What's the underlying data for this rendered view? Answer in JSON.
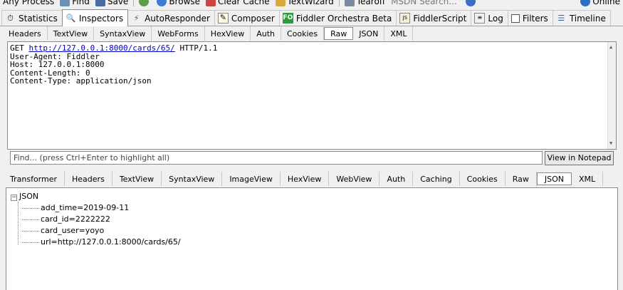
{
  "toolbar": {
    "items": [
      {
        "label": "Any Process",
        "icon": "crosshair-icon"
      },
      {
        "label": "Find",
        "icon": "find-icon"
      },
      {
        "label": "Save",
        "icon": "save-icon"
      },
      {
        "label": "",
        "icon": "snapshot-icon"
      },
      {
        "label": "Browse",
        "icon": "browse-icon"
      },
      {
        "label": "Clear Cache",
        "icon": "clear-cache-icon"
      },
      {
        "label": "TextWizard",
        "icon": "textwizard-icon"
      },
      {
        "label": "Tearoff",
        "icon": "tearoff-icon"
      }
    ],
    "search_placeholder": "MSDN Search...",
    "status": "Online"
  },
  "main_tabs": [
    {
      "label": "Statistics",
      "icon": "stopwatch-icon"
    },
    {
      "label": "Inspectors",
      "icon": "inspectors-icon",
      "active": true
    },
    {
      "label": "AutoResponder",
      "icon": "lightning-icon"
    },
    {
      "label": "Composer",
      "icon": "composer-icon"
    },
    {
      "label": "Fiddler Orchestra Beta",
      "icon": "fo-icon",
      "icon_text": "FO"
    },
    {
      "label": "FiddlerScript",
      "icon": "script-icon"
    },
    {
      "label": "Log",
      "icon": "log-icon"
    },
    {
      "label": "Filters",
      "icon": "checkbox-icon"
    },
    {
      "label": "Timeline",
      "icon": "timeline-icon"
    }
  ],
  "request_tabs": [
    "Headers",
    "TextView",
    "SyntaxView",
    "WebForms",
    "HexView",
    "Auth",
    "Cookies",
    "Raw",
    "JSON",
    "XML"
  ],
  "request_active": "Raw",
  "raw": {
    "method": "GET",
    "url": "http://127.0.0.1:8000/cards/65/",
    "protocol": "HTTP/1.1",
    "headers": [
      "User-Agent: Fiddler",
      "Host: 127.0.0.1:8000",
      "Content-Length: 0",
      "Content-Type: application/json"
    ]
  },
  "find": {
    "placeholder": "Find... (press Ctrl+Enter to highlight all)",
    "notepad_label": "View in Notepad"
  },
  "response_tabs": [
    "Transformer",
    "Headers",
    "TextView",
    "SyntaxView",
    "ImageView",
    "HexView",
    "WebView",
    "Auth",
    "Caching",
    "Cookies",
    "Raw",
    "JSON",
    "XML"
  ],
  "response_active": "JSON",
  "json_tree": {
    "root": "JSON",
    "children": [
      "add_time=2019-09-11",
      "card_id=2222222",
      "card_user=yoyo",
      "url=http://127.0.0.1:8000/cards/65/"
    ]
  },
  "colors": {
    "link": "#0000cc",
    "fo_bg": "#2e9b3a",
    "border": "#8a8a8a"
  }
}
